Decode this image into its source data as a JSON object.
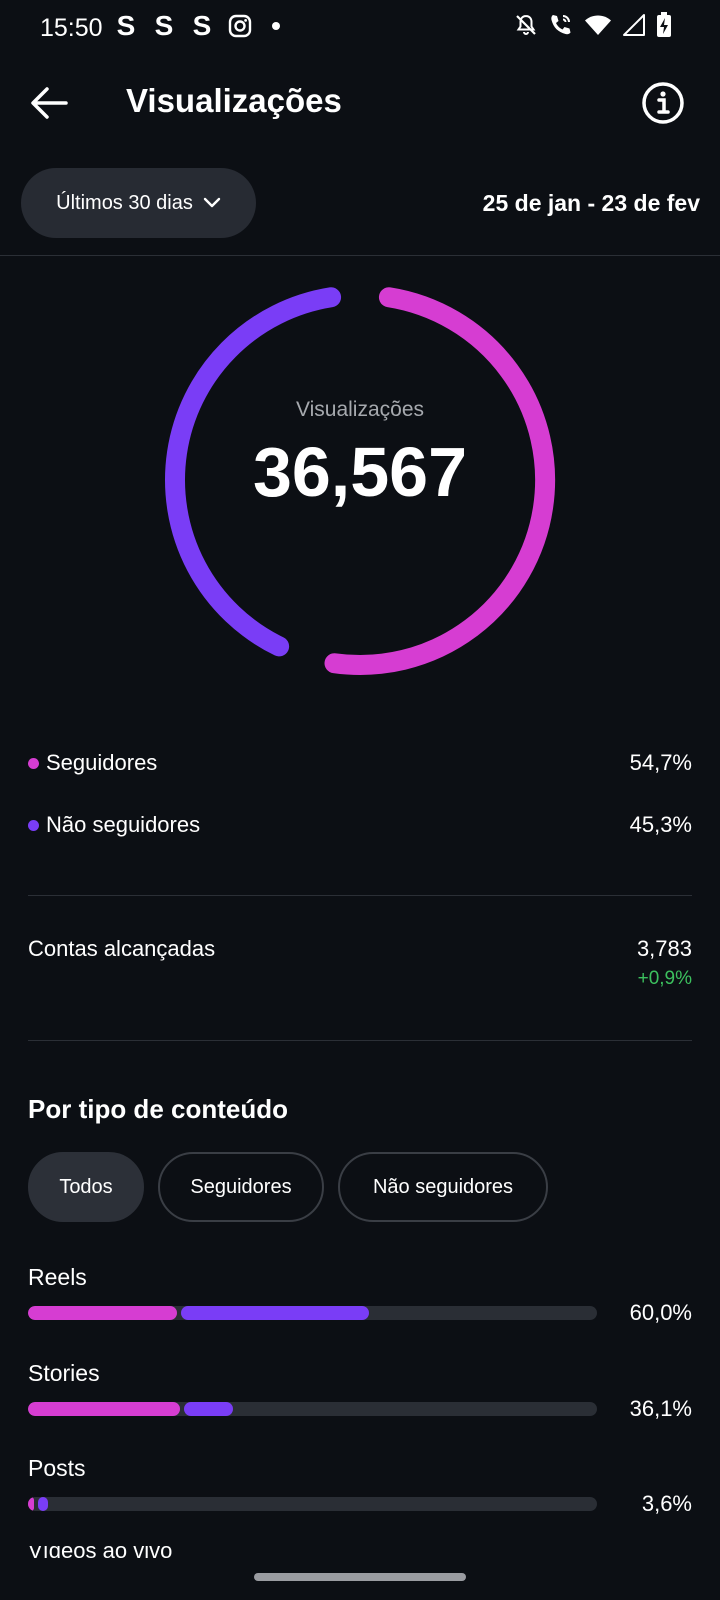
{
  "status_bar": {
    "time": "15:50",
    "app_icons": [
      "S",
      "S",
      "S"
    ],
    "icons": [
      "instagram-icon",
      "notification-dot",
      "bell-off-icon",
      "wifi-call-icon",
      "wifi-icon",
      "signal-icon",
      "battery-charging-icon"
    ]
  },
  "header": {
    "title": "Visualizações",
    "back_icon": "arrow-left-icon",
    "info_icon": "info-icon"
  },
  "filter": {
    "period_label": "Últimos 30 dias",
    "date_range": "25 de jan - 23 de fev"
  },
  "summary": {
    "caption": "Visualizações",
    "total": "36,567",
    "followers_fraction": 0.547,
    "non_followers_fraction": 0.453
  },
  "legend": [
    {
      "label": "Seguidores",
      "value": "54,7%",
      "color": "#d63dd2"
    },
    {
      "label": "Não seguidores",
      "value": "45,3%",
      "color": "#7a3df6"
    }
  ],
  "reach": {
    "label": "Contas alcançadas",
    "value": "3,783",
    "change": "+0,9%",
    "change_color": "#3cc05e"
  },
  "content_type": {
    "title": "Por tipo de conteúdo",
    "chips": [
      "Todos",
      "Seguidores",
      "Não seguidores"
    ],
    "active_chip": "Todos",
    "rows": [
      {
        "label": "Reels",
        "percent": "60,0%",
        "followers_fraction": 0.261,
        "non_followers_fraction": 0.339
      },
      {
        "label": "Stories",
        "percent": "36,1%",
        "followers_fraction": 0.268,
        "non_followers_fraction": 0.093
      },
      {
        "label": "Posts",
        "percent": "3,6%",
        "followers_fraction": 0.011,
        "non_followers_fraction": 0.025
      }
    ],
    "cutoff_label": "Vídeos ao vivo"
  },
  "colors": {
    "followers": "#d63dd2",
    "non_followers": "#7a3df6",
    "background": "#0c0f14",
    "chip_active": "#2c3038"
  }
}
